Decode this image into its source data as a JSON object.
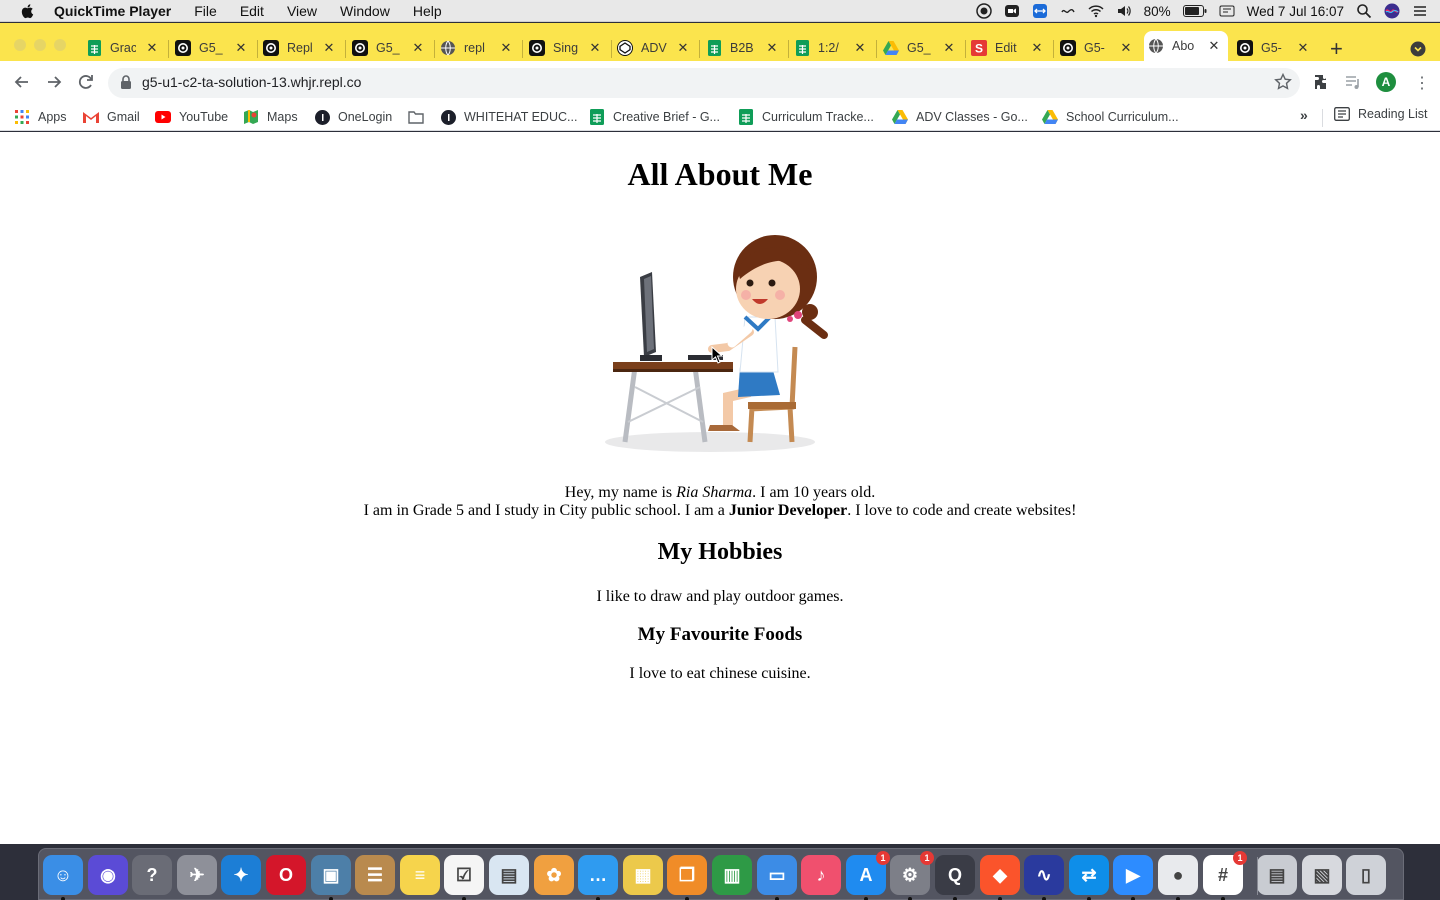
{
  "menubar": {
    "app_name": "QuickTime Player",
    "menus": [
      "File",
      "Edit",
      "View",
      "Window",
      "Help"
    ],
    "battery": "80%",
    "datetime": "Wed 7 Jul  16:07"
  },
  "tabs": [
    {
      "title": "Grac",
      "icon": "google-sheets-icon",
      "color": "#0f9d58"
    },
    {
      "title": "G5_",
      "icon": "replit-icon",
      "color": "#111111"
    },
    {
      "title": "Repl",
      "icon": "replit-icon",
      "color": "#111111"
    },
    {
      "title": "G5_",
      "icon": "replit-icon",
      "color": "#111111"
    },
    {
      "title": "repl",
      "icon": "globe-icon",
      "color": "#555555"
    },
    {
      "title": "Sing",
      "icon": "replit-icon",
      "color": "#111111"
    },
    {
      "title": "ADV",
      "icon": "codepen-icon",
      "color": "#111111"
    },
    {
      "title": "B2B",
      "icon": "google-sheets-icon",
      "color": "#0f9d58"
    },
    {
      "title": "1:2/",
      "icon": "google-sheets-icon",
      "color": "#0f9d58"
    },
    {
      "title": "G5_",
      "icon": "google-drive-icon",
      "color": "#fbbc04"
    },
    {
      "title": "Edit",
      "icon": "s-app-icon",
      "color": "#e53935"
    },
    {
      "title": "G5-",
      "icon": "replit-icon",
      "color": "#111111"
    },
    {
      "title": "Abo",
      "icon": "globe-icon",
      "color": "#555555",
      "active": true
    },
    {
      "title": "G5-",
      "icon": "replit-icon",
      "color": "#111111"
    }
  ],
  "address_bar": {
    "url": "g5-u1-c2-ta-solution-13.whjr.repl.co"
  },
  "bookmarks": {
    "items": [
      {
        "label": "Apps",
        "icon": "apps-grid-icon"
      },
      {
        "label": "Gmail",
        "icon": "gmail-icon"
      },
      {
        "label": "YouTube",
        "icon": "youtube-icon"
      },
      {
        "label": "Maps",
        "icon": "maps-icon"
      },
      {
        "label": "OneLogin",
        "icon": "onelogin-icon"
      },
      {
        "label": "",
        "icon": "folder-icon"
      },
      {
        "label": "WHITEHAT EDUC...",
        "icon": "onelogin-icon"
      },
      {
        "label": "Creative Brief - G...",
        "icon": "google-sheets-icon"
      },
      {
        "label": "Curriculum Tracke...",
        "icon": "google-sheets-icon"
      },
      {
        "label": "ADV Classes - Go...",
        "icon": "google-drive-icon"
      },
      {
        "label": "School Curriculum...",
        "icon": "google-drive-icon"
      }
    ],
    "more": "»",
    "reading_list": "Reading List"
  },
  "page": {
    "title": "All About Me",
    "intro_line1_pre": "Hey, my name is ",
    "intro_name": "Ria Sharma",
    "intro_line1_post": ". I am 10 years old.",
    "intro_line2_pre": "I am in Grade 5 and I study in City public school. I am a ",
    "intro_role": "Junior Developer",
    "intro_line2_post": ". I love to code and create websites!",
    "hobbies_heading": "My Hobbies",
    "hobbies_text": "I like to draw and play outdoor games.",
    "foods_heading": "My Favourite Foods",
    "foods_text": "I love to eat chinese cuisine."
  },
  "dock": {
    "apps": [
      {
        "name": "finder-icon",
        "color": "#3a8ee6"
      },
      {
        "name": "siri-icon",
        "color": "#5b4bd6"
      },
      {
        "name": "help-icon",
        "color": "#6a6c76"
      },
      {
        "name": "launchpad-icon",
        "color": "#8e9099"
      },
      {
        "name": "safari-icon",
        "color": "#1c7ed6"
      },
      {
        "name": "opera-icon",
        "color": "#d4162a"
      },
      {
        "name": "preview-icon",
        "color": "#4d7fa8"
      },
      {
        "name": "contacts-icon",
        "color": "#b98a4e"
      },
      {
        "name": "notes-icon",
        "color": "#f6d44c"
      },
      {
        "name": "reminders-icon",
        "color": "#f5f5f5"
      },
      {
        "name": "keynote-viewer-icon",
        "color": "#d9e6f2"
      },
      {
        "name": "photos-icon",
        "color": "#f0a040"
      },
      {
        "name": "messages-icon",
        "color": "#2f9bf0"
      },
      {
        "name": "slides-icon",
        "color": "#ecc94b"
      },
      {
        "name": "books-icon",
        "color": "#f08c28"
      },
      {
        "name": "numbers-icon",
        "color": "#2e9a46"
      },
      {
        "name": "keynote-icon",
        "color": "#3c8ce6"
      },
      {
        "name": "music-icon",
        "color": "#f0506e"
      },
      {
        "name": "app-store-icon",
        "color": "#1f8bf0",
        "badge": "1"
      },
      {
        "name": "system-preferences-icon",
        "color": "#7d7f88",
        "badge": "1"
      },
      {
        "name": "quicktime-icon",
        "color": "#3a3c46"
      },
      {
        "name": "brave-icon",
        "color": "#fb542b"
      },
      {
        "name": "audacity-icon",
        "color": "#2a3a9e"
      },
      {
        "name": "teamviewer-icon",
        "color": "#0e8ee9"
      },
      {
        "name": "zoom-icon",
        "color": "#2d8cff"
      },
      {
        "name": "chrome-icon",
        "color": "#e8eaed"
      },
      {
        "name": "slack-icon",
        "color": "#ffffff",
        "badge": "1"
      },
      {
        "name": "downloads-folder-icon",
        "color": "#c9ccd2"
      },
      {
        "name": "documents-stack-icon",
        "color": "#d7d9de"
      },
      {
        "name": "trash-icon",
        "color": "#cfd2d8"
      }
    ]
  }
}
